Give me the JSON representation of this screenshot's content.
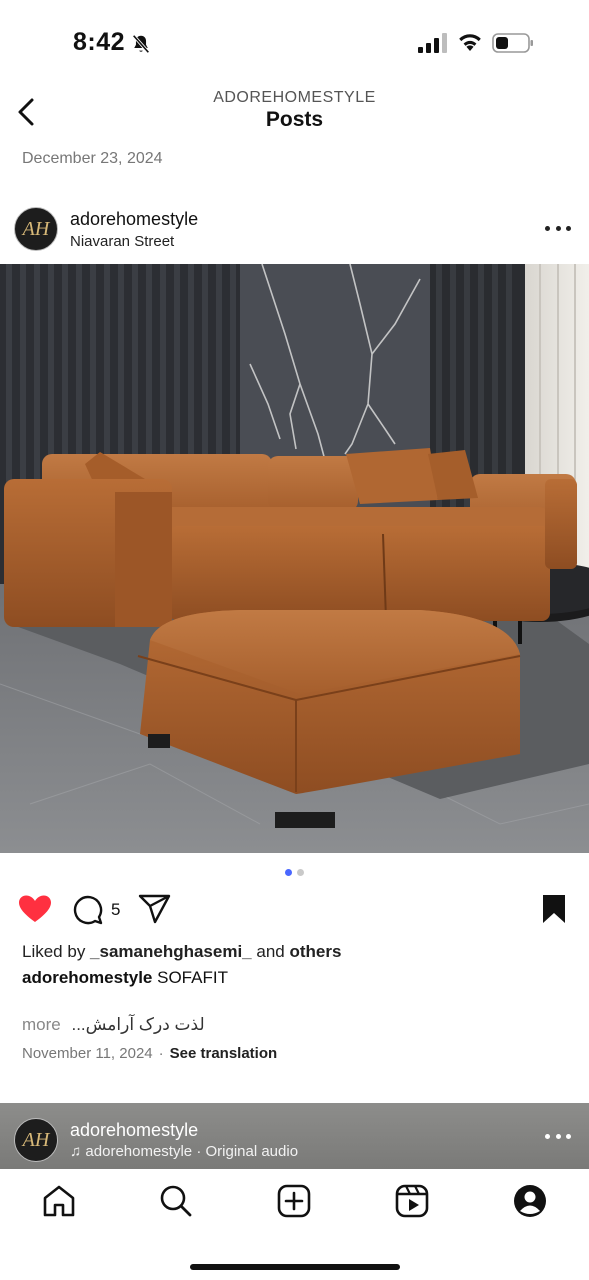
{
  "status_bar": {
    "time": "8:42"
  },
  "header": {
    "subtitle": "ADOREHOMESTYLE",
    "title": "Posts"
  },
  "date_top": "December 23, 2024",
  "post": {
    "username": "adorehomestyle",
    "location": "Niavaran Street",
    "avatar_text": "AH",
    "comment_count": "5",
    "liked_by_prefix": "Liked by ",
    "liked_by_user": "_samanehghasemi_",
    "liked_by_mid": " and ",
    "liked_by_others": "others",
    "caption_user": "adorehomestyle",
    "caption_text": "SOFAFIT",
    "more_label": "more",
    "translated_text": "لذت درک آرامش...",
    "date": "November 11, 2024",
    "separator": "·",
    "see_translation": "See translation",
    "carousel_pages": 2,
    "carousel_active": 1
  },
  "next_post": {
    "username": "adorehomestyle",
    "audio": "adorehomestyle · Original audio"
  },
  "colors": {
    "like_red": "#ff3040",
    "carousel_active": "#4a67ff",
    "sofa_leather": "#a9602f"
  },
  "icons": [
    "bell-off-icon",
    "signal-icon",
    "wifi-icon",
    "battery-icon",
    "back-icon",
    "more-icon",
    "heart-icon",
    "comment-icon",
    "share-icon",
    "bookmark-icon",
    "music-note-icon",
    "home-icon",
    "search-icon",
    "create-icon",
    "reels-icon",
    "profile-icon"
  ]
}
